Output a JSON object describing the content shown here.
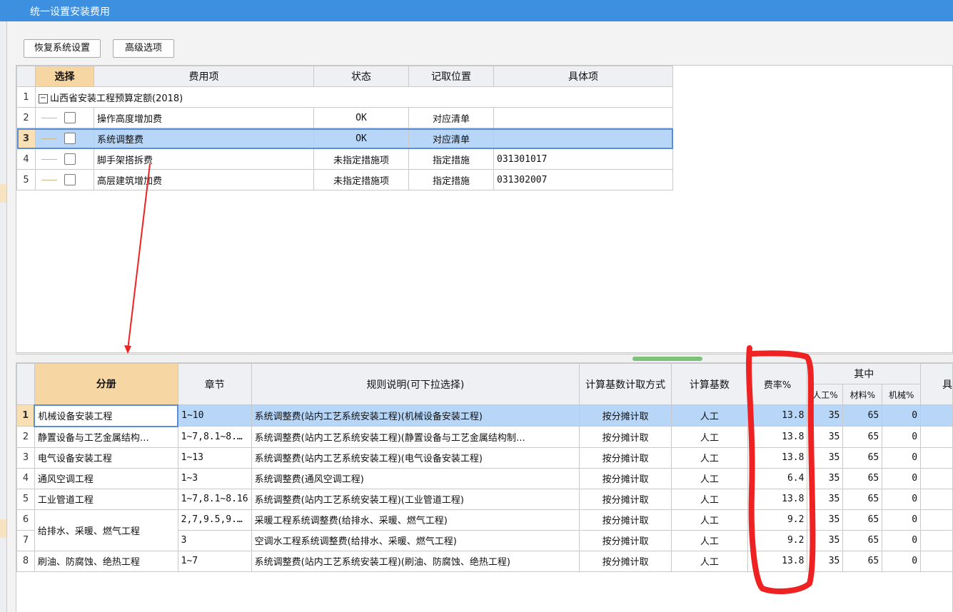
{
  "window": {
    "title": "统一设置安装费用"
  },
  "toolbar": {
    "restore_label": "恢复系统设置",
    "advanced_label": "高级选项"
  },
  "top_table": {
    "headers": {
      "select": "选择",
      "fee_item": "费用项",
      "status": "状态",
      "position": "记取位置",
      "detail": "具体项"
    },
    "root": {
      "num": "1",
      "label": "山西省安装工程预算定额(2018)"
    },
    "rows": [
      {
        "num": "2",
        "fee": "操作高度增加费",
        "status": "OK",
        "position": "对应清单",
        "detail": ""
      },
      {
        "num": "3",
        "fee": "系统调整费",
        "status": "OK",
        "position": "对应清单",
        "detail": ""
      },
      {
        "num": "4",
        "fee": "脚手架搭拆费",
        "status": "未指定措施项",
        "position": "指定措施",
        "detail": "031301017"
      },
      {
        "num": "5",
        "fee": "高层建筑增加费",
        "status": "未指定措施项",
        "position": "指定措施",
        "detail": "031302007"
      }
    ]
  },
  "bottom_table": {
    "headers": {
      "volume": "分册",
      "chapter": "章节",
      "rule": "规则说明(可下拉选择)",
      "calc_method": "计算基数计取方式",
      "calc_base": "计算基数",
      "rate": "费率%",
      "of_which": "其中",
      "labor": "人工%",
      "material": "材料%",
      "machine": "机械%",
      "extra": "具"
    },
    "rows": [
      {
        "num": "1",
        "volume": "机械设备安装工程",
        "chapter": "1~10",
        "rule": "系统调整费(站内工艺系统安装工程)(机械设备安装工程)",
        "method": "按分摊计取",
        "base": "人工",
        "rate": "13.8",
        "labor": "35",
        "material": "65",
        "machine": "0"
      },
      {
        "num": "2",
        "volume": "静置设备与工艺金属结构…",
        "chapter": "1~7,8.1~8.…",
        "rule": "系统调整费(站内工艺系统安装工程)(静置设备与工艺金属结构制…",
        "method": "按分摊计取",
        "base": "人工",
        "rate": "13.8",
        "labor": "35",
        "material": "65",
        "machine": "0"
      },
      {
        "num": "3",
        "volume": "电气设备安装工程",
        "chapter": "1~13",
        "rule": "系统调整费(站内工艺系统安装工程)(电气设备安装工程)",
        "method": "按分摊计取",
        "base": "人工",
        "rate": "13.8",
        "labor": "35",
        "material": "65",
        "machine": "0"
      },
      {
        "num": "4",
        "volume": "通风空调工程",
        "chapter": "1~3",
        "rule": "系统调整费(通风空调工程)",
        "method": "按分摊计取",
        "base": "人工",
        "rate": "6.4",
        "labor": "35",
        "material": "65",
        "machine": "0"
      },
      {
        "num": "5",
        "volume": "工业管道工程",
        "chapter": "1~7,8.1~8.16",
        "rule": "系统调整费(站内工艺系统安装工程)(工业管道工程)",
        "method": "按分摊计取",
        "base": "人工",
        "rate": "13.8",
        "labor": "35",
        "material": "65",
        "machine": "0"
      },
      {
        "num": "6",
        "volume": "给排水、采暖、燃气工程",
        "chapter": "2,7,9.5,9.…",
        "rule": "采暖工程系统调整费(给排水、采暖、燃气工程)",
        "method": "按分摊计取",
        "base": "人工",
        "rate": "9.2",
        "labor": "35",
        "material": "65",
        "machine": "0"
      },
      {
        "num": "7",
        "volume": "",
        "chapter": "3",
        "rule": "空调水工程系统调整费(给排水、采暖、燃气工程)",
        "method": "按分摊计取",
        "base": "人工",
        "rate": "9.2",
        "labor": "35",
        "material": "65",
        "machine": "0"
      },
      {
        "num": "8",
        "volume": "刷油、防腐蚀、绝热工程",
        "chapter": "1~7",
        "rule": "系统调整费(站内工艺系统安装工程)(刷油、防腐蚀、绝热工程)",
        "method": "按分摊计取",
        "base": "人工",
        "rate": "13.8",
        "labor": "35",
        "material": "65",
        "machine": "0"
      }
    ]
  },
  "colors": {
    "title_bar": "#3d8fe0",
    "selected_row": "#b7d6f8",
    "header_highlight": "#f6d7a4",
    "annotation_red": "#ee2222"
  }
}
